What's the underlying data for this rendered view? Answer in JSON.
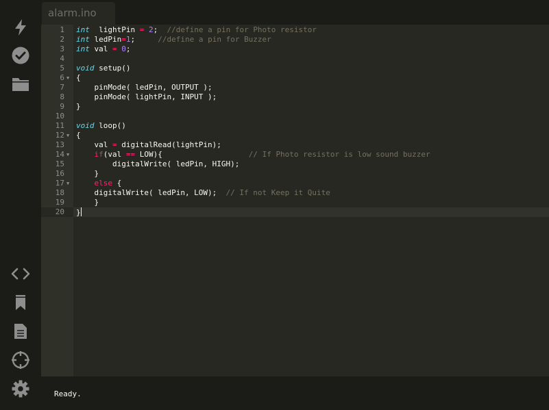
{
  "sidebar": {
    "top_icons": [
      {
        "icon": "lightning-icon",
        "label": "Upload"
      },
      {
        "icon": "check-circle-icon",
        "label": "Verify"
      },
      {
        "icon": "folder-icon",
        "label": "Open"
      }
    ],
    "bottom_icons": [
      {
        "icon": "code-icon"
      },
      {
        "icon": "bookmark-icon"
      },
      {
        "icon": "document-icon"
      },
      {
        "icon": "crosshair-icon"
      },
      {
        "icon": "gear-icon"
      }
    ]
  },
  "tab": {
    "label": "alarm.ino"
  },
  "editor": {
    "active_line": 20,
    "lines": [
      {
        "n": "1",
        "fold": false,
        "tokens": [
          [
            "kw-type",
            "int"
          ],
          [
            "",
            "  lightPin "
          ],
          [
            "op",
            "="
          ],
          [
            "",
            " "
          ],
          [
            "num-lit",
            "2"
          ],
          [
            "",
            ";  "
          ],
          [
            "cmt",
            "//define a pin for Photo resistor"
          ]
        ]
      },
      {
        "n": "2",
        "fold": false,
        "tokens": [
          [
            "kw-type",
            "int"
          ],
          [
            "",
            " ledPin"
          ],
          [
            "op",
            "="
          ],
          [
            "num-lit",
            "1"
          ],
          [
            "",
            ";     "
          ],
          [
            "cmt",
            "//define a pin for Buzzer"
          ]
        ]
      },
      {
        "n": "3",
        "fold": false,
        "tokens": [
          [
            "kw-type",
            "int"
          ],
          [
            "",
            " val "
          ],
          [
            "op",
            "="
          ],
          [
            "",
            " "
          ],
          [
            "num-lit",
            "0"
          ],
          [
            "",
            ";"
          ]
        ]
      },
      {
        "n": "4",
        "fold": false,
        "tokens": []
      },
      {
        "n": "5",
        "fold": false,
        "tokens": [
          [
            "kw-type",
            "void"
          ],
          [
            "",
            " setup()"
          ]
        ]
      },
      {
        "n": "6",
        "fold": true,
        "tokens": [
          [
            "",
            "{"
          ]
        ]
      },
      {
        "n": "7",
        "fold": false,
        "tokens": [
          [
            "",
            "    pinMode( ledPin, OUTPUT );"
          ]
        ]
      },
      {
        "n": "8",
        "fold": false,
        "tokens": [
          [
            "",
            "    pinMode( lightPin, INPUT );"
          ]
        ]
      },
      {
        "n": "9",
        "fold": false,
        "tokens": [
          [
            "",
            "}"
          ]
        ]
      },
      {
        "n": "10",
        "fold": false,
        "tokens": []
      },
      {
        "n": "11",
        "fold": false,
        "tokens": [
          [
            "kw-type",
            "void"
          ],
          [
            "",
            " loop()"
          ]
        ]
      },
      {
        "n": "12",
        "fold": true,
        "tokens": [
          [
            "",
            "{"
          ]
        ]
      },
      {
        "n": "13",
        "fold": false,
        "tokens": [
          [
            "",
            "    val "
          ],
          [
            "op",
            "="
          ],
          [
            "",
            " digitalRead(lightPin);"
          ]
        ]
      },
      {
        "n": "14",
        "fold": true,
        "tokens": [
          [
            "",
            "    "
          ],
          [
            "kw",
            "if"
          ],
          [
            "",
            "(val "
          ],
          [
            "op",
            "=="
          ],
          [
            "",
            " LOW){                   "
          ],
          [
            "cmt",
            "// If Photo resistor is low sound buzzer"
          ]
        ]
      },
      {
        "n": "15",
        "fold": false,
        "tokens": [
          [
            "",
            "        digitalWrite( ledPin, HIGH);"
          ]
        ]
      },
      {
        "n": "16",
        "fold": false,
        "tokens": [
          [
            "",
            "    }"
          ]
        ]
      },
      {
        "n": "17",
        "fold": true,
        "tokens": [
          [
            "",
            "    "
          ],
          [
            "kw",
            "else"
          ],
          [
            "",
            " {"
          ]
        ]
      },
      {
        "n": "18",
        "fold": false,
        "tokens": [
          [
            "",
            "    digitalWrite( ledPin, LOW);  "
          ],
          [
            "cmt",
            "// If not Keep it Quite"
          ]
        ]
      },
      {
        "n": "19",
        "fold": false,
        "tokens": [
          [
            "",
            "    }"
          ]
        ]
      },
      {
        "n": "20",
        "fold": false,
        "tokens": [
          [
            "",
            "}"
          ]
        ]
      }
    ]
  },
  "status": {
    "text": "Ready."
  },
  "colors": {
    "sidebar_bg": "#1b1b18",
    "editor_bg": "#272822",
    "gutter_bg": "#2f3129",
    "keyword_type": "#66d9ef",
    "keyword": "#f92672",
    "number": "#ae81ff",
    "comment": "#75715e",
    "text": "#f8f8f2",
    "icon": "#8e8e8e"
  }
}
